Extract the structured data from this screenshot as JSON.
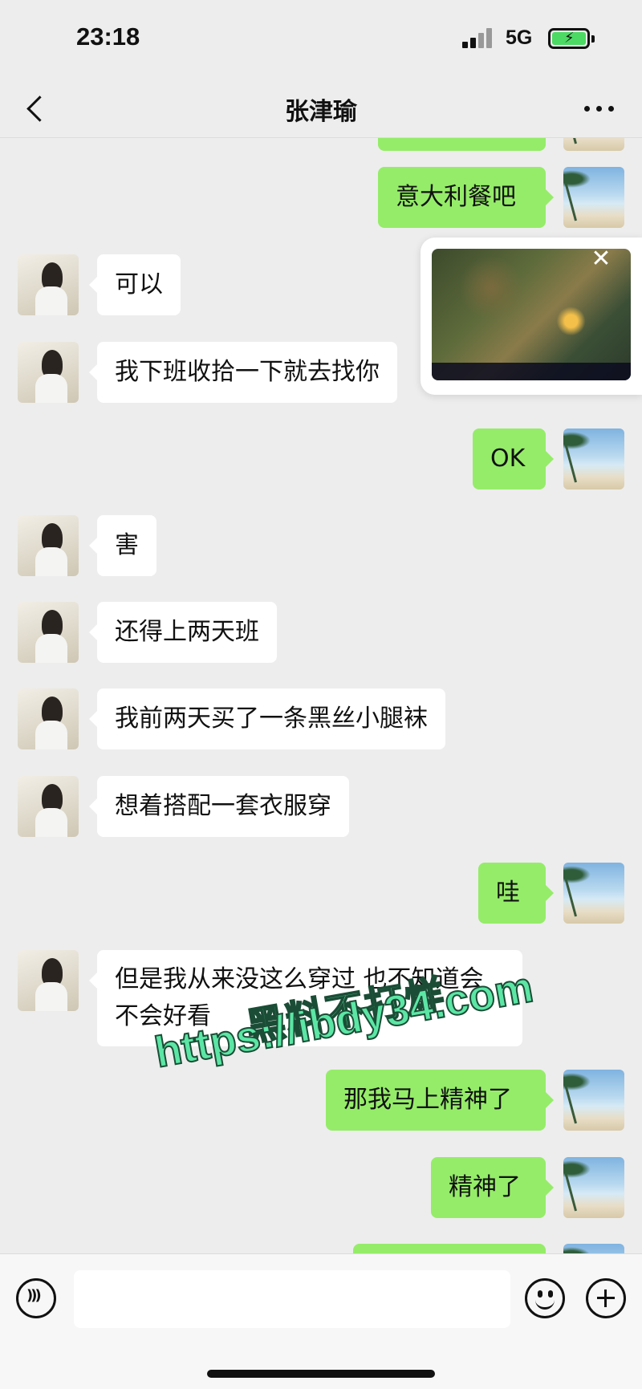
{
  "status_bar": {
    "time": "23:18",
    "network": "5G",
    "battery_icon": "battery-charging-icon"
  },
  "nav": {
    "title": "张津瑜",
    "back_icon": "chevron-left-icon",
    "more_icon": "more-dots-icon"
  },
  "messages": [
    {
      "side": "right",
      "text": "意大利餐吧"
    },
    {
      "side": "left",
      "text": "可以"
    },
    {
      "side": "left",
      "text": "我下班收拾一下就去找你"
    },
    {
      "side": "right",
      "text": "OK"
    },
    {
      "side": "left",
      "text": "害"
    },
    {
      "side": "left",
      "text": "还得上两天班"
    },
    {
      "side": "left",
      "text": "我前两天买了一条黑丝小腿袜"
    },
    {
      "side": "left",
      "text": "想着搭配一套衣服穿"
    },
    {
      "side": "right",
      "text": "哇"
    },
    {
      "side": "left",
      "text": "但是我从来没这么穿过 也不知道会不会好看"
    },
    {
      "side": "right",
      "text": "那我马上精神了"
    },
    {
      "side": "right",
      "text": "精神了"
    }
  ],
  "floating_video": {
    "close_icon": "close-icon"
  },
  "watermark": {
    "line1": "黑料不打烊",
    "line2": "https://ibdy34.com"
  },
  "input_bar": {
    "voice_icon": "voice-icon",
    "emoji_icon": "emoji-icon",
    "plus_icon": "plus-icon"
  }
}
